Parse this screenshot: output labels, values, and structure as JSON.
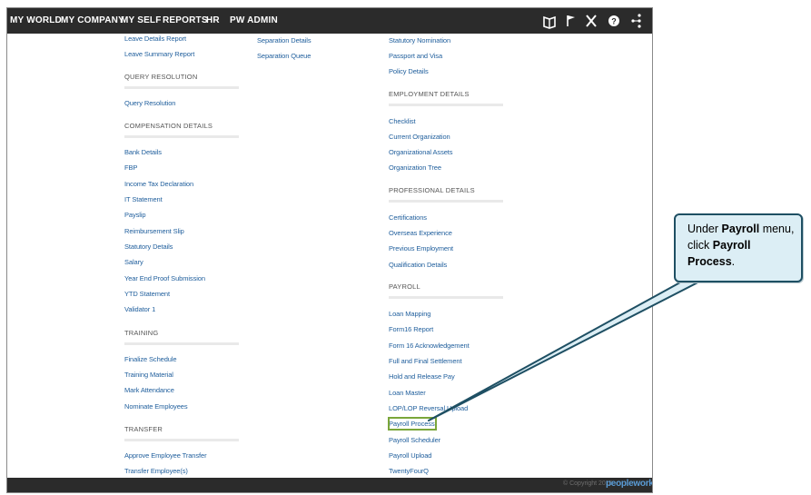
{
  "topnav": {
    "items": [
      "MY WORLD",
      "MY COMPANY",
      "MY SELF",
      "REPORTS",
      "HR",
      "PW ADMIN"
    ],
    "icons": [
      "book-icon",
      "flag-icon",
      "tools-icon",
      "help-icon",
      "share-icon"
    ],
    "help_glyph": "?"
  },
  "col1": {
    "links_top": [
      "Leave Details Report",
      "Leave Summary Report"
    ],
    "sections": [
      {
        "title": "QUERY RESOLUTION",
        "links": [
          "Query Resolution"
        ]
      },
      {
        "title": "COMPENSATION DETAILS",
        "links": [
          "Bank Details",
          "FBP",
          "Income Tax Declaration",
          "IT Statement",
          "Payslip",
          "Reimbursement Slip",
          "Statutory Details",
          "Salary",
          "Year End Proof Submission",
          "YTD Statement",
          "Validator 1"
        ]
      },
      {
        "title": "TRAINING",
        "links": [
          "Finalize Schedule",
          "Training Material",
          "Mark Attendance",
          "Nominate Employees"
        ]
      },
      {
        "title": "TRANSFER",
        "links": [
          "Approve Employee Transfer",
          "Transfer Employee(s)"
        ]
      }
    ]
  },
  "col2": {
    "links_top": [
      "Separation Details",
      "Separation Queue"
    ]
  },
  "col3": {
    "links_top": [
      "Statutory Nomination",
      "Passport and Visa",
      "Policy Details"
    ],
    "sections": [
      {
        "title": "EMPLOYMENT DETAILS",
        "links": [
          "Checklist",
          "Current Organization",
          "Organizational Assets",
          "Organization Tree"
        ]
      },
      {
        "title": "PROFESSIONAL DETAILS",
        "links": [
          "Certifications",
          "Overseas Experience",
          "Previous Employment",
          "Qualification Details"
        ]
      },
      {
        "title": "PAYROLL",
        "links": [
          "Loan Mapping",
          "Form16 Report",
          "Form 16 Acknowledgement",
          "Full and Final Settlement",
          "Hold and Release Pay",
          "Loan Master",
          "LOP/LOP Reversal Upload",
          "Payroll Process",
          "Payroll Scheduler",
          "Payroll Upload",
          "TwentyFourQ"
        ]
      }
    ]
  },
  "footer": {
    "copyright": "© Copyright 2015",
    "brand": "peopleworks"
  },
  "callout": {
    "pre": "Under ",
    "menu": "Payroll",
    "mid": " menu, click ",
    "target": "Payroll Process",
    "post": "."
  },
  "colors": {
    "nav_bg": "#2b2b2b",
    "link": "#1f5e9c",
    "highlight": "#7aa63a",
    "callout_bg": "#dceef5",
    "callout_border": "#1e4f63"
  }
}
